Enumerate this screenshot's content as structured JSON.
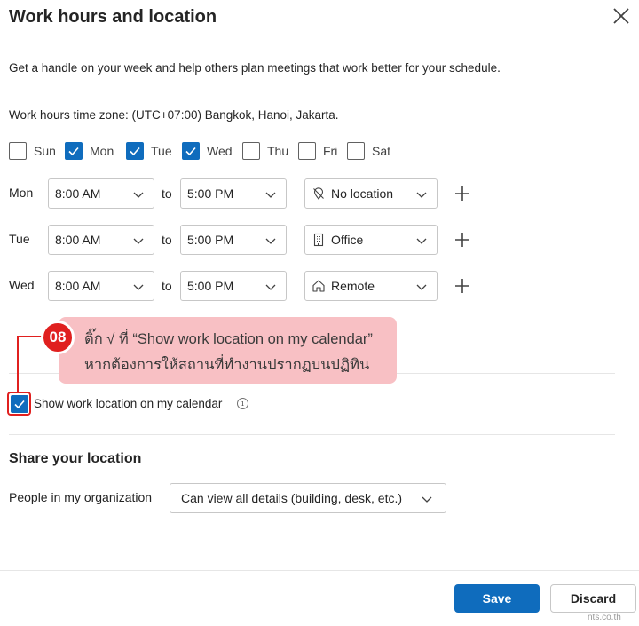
{
  "dialog": {
    "title": "Work hours and location",
    "description": "Get a handle on your week and help others plan meetings that work better for your schedule.",
    "timezone_label": "Work hours time zone: (UTC+07:00) Bangkok, Hanoi, Jakarta."
  },
  "days": [
    {
      "label": "Sun",
      "checked": false
    },
    {
      "label": "Mon",
      "checked": true
    },
    {
      "label": "Tue",
      "checked": true
    },
    {
      "label": "Wed",
      "checked": true
    },
    {
      "label": "Thu",
      "checked": false
    },
    {
      "label": "Fri",
      "checked": false
    },
    {
      "label": "Sat",
      "checked": false
    }
  ],
  "schedule": [
    {
      "day": "Mon",
      "start": "8:00 AM",
      "to": "to",
      "end": "5:00 PM",
      "location": "No location",
      "location_icon": "no-location-icon"
    },
    {
      "day": "Tue",
      "start": "8:00 AM",
      "to": "to",
      "end": "5:00 PM",
      "location": "Office",
      "location_icon": "office-building-icon"
    },
    {
      "day": "Wed",
      "start": "8:00 AM",
      "to": "to",
      "end": "5:00 PM",
      "location": "Remote",
      "location_icon": "home-icon"
    }
  ],
  "annotation": {
    "step": "08",
    "line1": "ติ๊ก √ ที่ “Show work location on my calendar”",
    "line2": "หากต้องการให้สถานที่ทำงานปรากฏบนปฏิทิน"
  },
  "show_location": {
    "label": "Show work location on my calendar",
    "checked": true,
    "info_icon": "i"
  },
  "share": {
    "heading": "Share your location",
    "label": "People in my organization",
    "value": "Can view all details (building, desk, etc.)"
  },
  "footer": {
    "save_label": "Save",
    "discard_label": "Discard",
    "watermark": "nts.co.th"
  },
  "colors": {
    "accent": "#0f6cbd",
    "annotation_red": "#e0201f",
    "callout_pink": "#f8c0c4"
  }
}
